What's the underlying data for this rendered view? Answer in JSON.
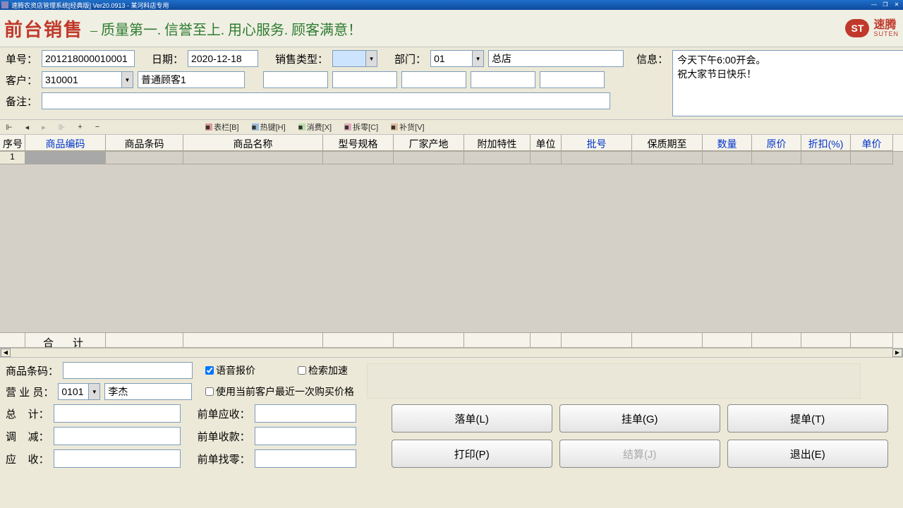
{
  "window": {
    "title": "速腾农资店管理系统[经典版] Ver20.0913  -  某河科店专用"
  },
  "header": {
    "title": "前台销售",
    "slogan": "– 质量第一. 信誉至上. 用心服务. 顾客满意！",
    "logo_cn": "速腾",
    "logo_en": "SUTEN",
    "logo_mark": "ST"
  },
  "form": {
    "order_no_label": "单号：",
    "order_no": "201218000010001",
    "date_label": "日期：",
    "date": "2020-12-18",
    "sale_type_label": "销售类型：",
    "sale_type": "",
    "dept_label": "部门：",
    "dept_code": "01",
    "dept_name": "总店",
    "customer_label": "客户：",
    "customer_code": "310001",
    "customer_name": "普通顾客1",
    "remark_label": "备注：",
    "info_label": "信息：",
    "info_line1": "今天下午6:00开会。",
    "info_line2": "祝大家节日快乐！"
  },
  "toolbar": {
    "nav_first": "⏮",
    "nav_prev": "◀",
    "nav_next": "▶",
    "nav_last": "⏭",
    "add": "+",
    "del": "−",
    "b1": "表栏[B]",
    "b2": "热键[H]",
    "b3": "消费[X]",
    "b4": "拆零[C]",
    "b5": "补货[V]"
  },
  "table": {
    "cols": [
      "序号",
      "商品编码",
      "商品条码",
      "商品名称",
      "型号规格",
      "厂家产地",
      "附加特性",
      "单位",
      "批号",
      "保质期至",
      "数量",
      "原价",
      "折扣(%)",
      "单价"
    ],
    "row1_seq": "1",
    "footer": "合　计"
  },
  "bottom": {
    "barcode_label": "商品条码：",
    "salesman_label": "营 业 员：",
    "salesman_code": "0101",
    "salesman_name": "李杰",
    "cb_voice": "语音报价",
    "cb_speed": "检索加速",
    "cb_lastprice": "使用当前客户最近一次购买价格",
    "total_label": "总　计：",
    "adjust_label": "调　减：",
    "receive_label": "应　收：",
    "prev_due_label": "前单应收：",
    "prev_paid_label": "前单收款：",
    "prev_change_label": "前单找零：",
    "btn_drop": "落单(L)",
    "btn_hold": "挂单(G)",
    "btn_pick": "提单(T)",
    "btn_print": "打印(P)",
    "btn_settle": "结算(J)",
    "btn_exit": "退出(E)"
  }
}
